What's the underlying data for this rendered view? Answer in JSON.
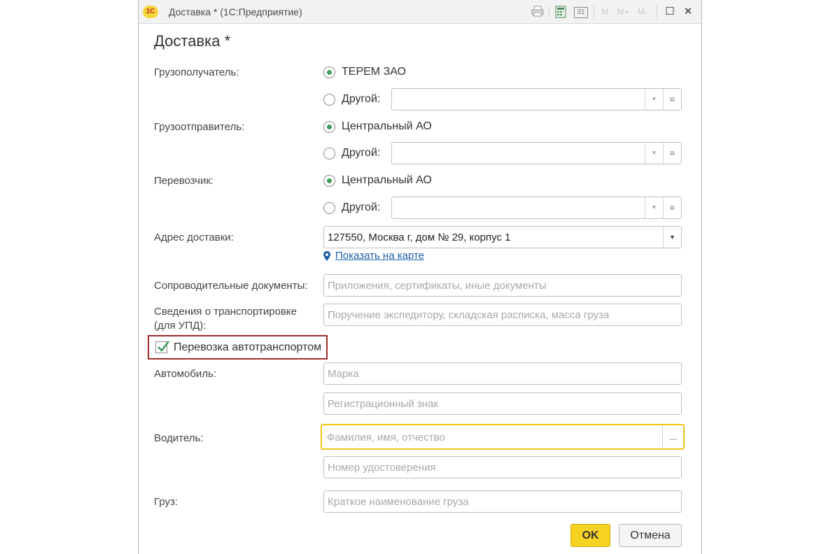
{
  "window": {
    "title": "Доставка * (1С:Предприятие)",
    "logo": "1С",
    "toolbar_icons": [
      "print-icon",
      "calculator-icon",
      "calendar-icon",
      "m-icon",
      "m-plus-icon",
      "m-minus-icon"
    ],
    "toolbar_text": {
      "calendar": "31",
      "m": "M",
      "mplus": "M+",
      "mminus": "M-"
    },
    "controls": {
      "maximize": "☐",
      "close": "✕"
    }
  },
  "form": {
    "heading": "Доставка *",
    "consignee": {
      "label": "Грузополучатель:",
      "option1": "ТЕРЕМ ЗАО",
      "option2": "Другой:",
      "selected": 1,
      "other_value": ""
    },
    "shipper": {
      "label": "Грузоотправитель:",
      "option1": "Центральный АО",
      "option2": "Другой:",
      "selected": 1,
      "other_value": ""
    },
    "carrier": {
      "label": "Перевозчик:",
      "option1": "Центральный АО",
      "option2": "Другой:",
      "selected": 1,
      "other_value": ""
    },
    "address": {
      "label": "Адрес доставки:",
      "value": "127550, Москва г, дом № 29, корпус 1",
      "map_link": "Показать на карте"
    },
    "docs": {
      "label": "Сопроводительные документы:",
      "placeholder": "Приложения, сертификаты, иные документы"
    },
    "transport_info": {
      "label_line1": "Сведения о транспортировке",
      "label_line2": "(для УПД):",
      "placeholder": "Поручение экспедитору, складская расписка, масса груза"
    },
    "by_road": {
      "label": "Перевозка автотранспортом",
      "checked": true
    },
    "car": {
      "label": "Автомобиль:",
      "brand_placeholder": "Марка",
      "plate_placeholder": "Регистрационный знак"
    },
    "driver": {
      "label": "Водитель:",
      "name_placeholder": "Фамилия, имя, отчество",
      "select_button": "...",
      "license_placeholder": "Номер удостоверения"
    },
    "cargo": {
      "label": "Груз:",
      "placeholder": "Краткое наименование груза"
    }
  },
  "buttons": {
    "ok": "OK",
    "cancel": "Отмена"
  },
  "colors": {
    "accent": "#f7d321",
    "radio_on": "#3f9c5b",
    "check": "#3f9c5b",
    "link": "#1c5fa8",
    "highlight_frame": "#a02a2a",
    "focus_border": "#f0c419"
  }
}
